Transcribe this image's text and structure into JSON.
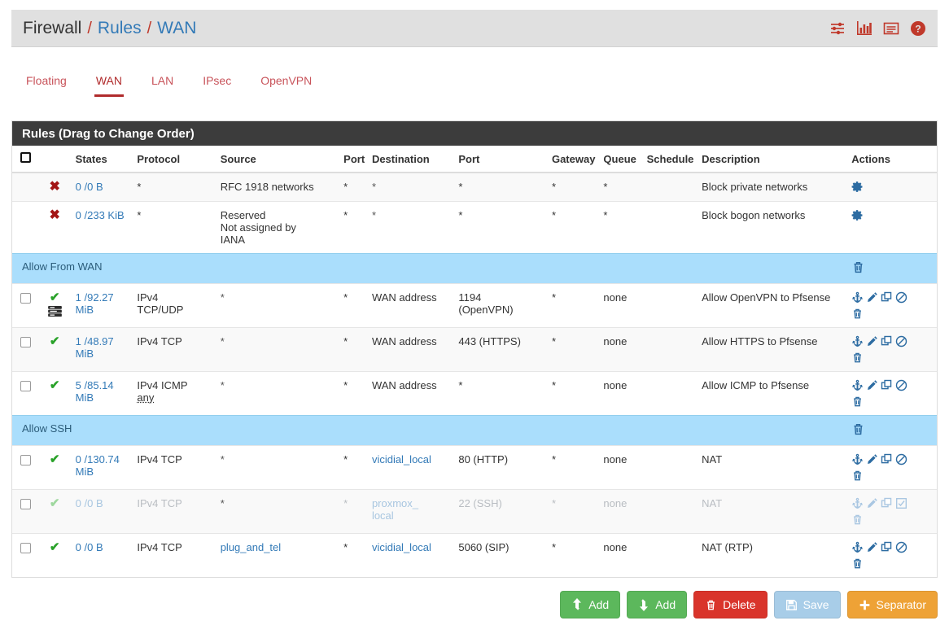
{
  "header": {
    "breadcrumb": [
      {
        "text": "Firewall",
        "type": "static"
      },
      {
        "text": "Rules",
        "type": "link"
      },
      {
        "text": "WAN",
        "type": "link"
      }
    ],
    "separator": "/",
    "icons": [
      {
        "name": "sliders-icon",
        "title": "Advanced"
      },
      {
        "name": "bar-chart-icon",
        "title": "Status"
      },
      {
        "name": "log-list-icon",
        "title": "Logs"
      },
      {
        "name": "help-icon",
        "title": "Help"
      }
    ],
    "accent_color": "#c0392b",
    "link_color": "#337ab7"
  },
  "tabs": [
    {
      "label": "Floating",
      "active": false
    },
    {
      "label": "WAN",
      "active": true
    },
    {
      "label": "LAN",
      "active": false
    },
    {
      "label": "IPsec",
      "active": false
    },
    {
      "label": "OpenVPN",
      "active": false
    }
  ],
  "panel": {
    "title": "Rules (Drag to Change Order)",
    "columns": [
      "",
      "",
      "States",
      "Protocol",
      "Source",
      "Port",
      "Destination",
      "Port",
      "Gateway",
      "Queue",
      "Schedule",
      "Description",
      "Actions"
    ],
    "col_labels": {
      "states": "States",
      "protocol": "Protocol",
      "source": "Source",
      "source_port": "Port",
      "destination": "Destination",
      "dest_port": "Port",
      "gateway": "Gateway",
      "queue": "Queue",
      "schedule": "Schedule",
      "description": "Description",
      "actions": "Actions"
    }
  },
  "rows": [
    {
      "kind": "rule",
      "checkbox": false,
      "status": "block",
      "logged": false,
      "disabled": false,
      "alt": true,
      "states": "0 /0 B",
      "protocol": "*",
      "protocol2": "",
      "source": "RFC 1918 networks",
      "source_link": false,
      "source_port": "*",
      "destination": "*",
      "destination_link": false,
      "dest_port": "*",
      "gateway": "*",
      "queue": "*",
      "schedule": "",
      "description": "Block private networks",
      "actions": [
        "gear-icon"
      ]
    },
    {
      "kind": "rule",
      "checkbox": false,
      "status": "block",
      "logged": false,
      "disabled": false,
      "alt": false,
      "states": "0 /233 KiB",
      "protocol": "*",
      "protocol2": "",
      "source": "Reserved\nNot assigned by\nIANA",
      "source_link": false,
      "source_port": "*",
      "destination": "*",
      "destination_link": false,
      "dest_port": "*",
      "gateway": "*",
      "queue": "*",
      "schedule": "",
      "description": "Block bogon networks",
      "actions": [
        "gear-icon"
      ]
    },
    {
      "kind": "separator",
      "label": "Allow From WAN",
      "actions": [
        "trash-icon"
      ]
    },
    {
      "kind": "rule",
      "checkbox": true,
      "status": "pass",
      "logged": true,
      "disabled": false,
      "alt": false,
      "states": "1 /92.27 MiB",
      "protocol": "IPv4",
      "protocol2": "TCP/UDP",
      "source": "*",
      "source_link": false,
      "source_port": "*",
      "destination": "WAN address",
      "destination_link": false,
      "dest_port": "1194\n(OpenVPN)",
      "gateway": "*",
      "queue": "none",
      "schedule": "",
      "description": "Allow OpenVPN to Pfsense",
      "actions": [
        "anchor-icon",
        "pencil-icon",
        "copy-icon",
        "ban-icon",
        "trash-icon"
      ]
    },
    {
      "kind": "rule",
      "checkbox": true,
      "status": "pass",
      "logged": false,
      "disabled": false,
      "alt": true,
      "states": "1 /48.97 MiB",
      "protocol": "IPv4 TCP",
      "protocol2": "",
      "source": "*",
      "source_link": false,
      "source_port": "*",
      "destination": "WAN address",
      "destination_link": false,
      "dest_port": "443 (HTTPS)",
      "gateway": "*",
      "queue": "none",
      "schedule": "",
      "description": "Allow HTTPS to Pfsense",
      "actions": [
        "anchor-icon",
        "pencil-icon",
        "copy-icon",
        "ban-icon",
        "trash-icon"
      ]
    },
    {
      "kind": "rule",
      "checkbox": true,
      "status": "pass",
      "logged": false,
      "disabled": false,
      "alt": false,
      "states": "5 /85.14 MiB",
      "protocol": "IPv4 ICMP",
      "protocol2": "any",
      "source": "*",
      "source_link": false,
      "source_port": "*",
      "destination": "WAN address",
      "destination_link": false,
      "dest_port": "*",
      "gateway": "*",
      "queue": "none",
      "schedule": "",
      "description": "Allow ICMP to Pfsense",
      "actions": [
        "anchor-icon",
        "pencil-icon",
        "copy-icon",
        "ban-icon",
        "trash-icon"
      ]
    },
    {
      "kind": "separator",
      "label": "Allow SSH",
      "actions": [
        "trash-icon"
      ]
    },
    {
      "kind": "rule",
      "checkbox": true,
      "status": "pass",
      "logged": false,
      "disabled": false,
      "alt": false,
      "states": "0 /130.74 MiB",
      "protocol": "IPv4 TCP",
      "protocol2": "",
      "source": "*",
      "source_link": false,
      "source_port": "*",
      "destination": "vicidial_local",
      "destination_link": true,
      "dest_port": "80 (HTTP)",
      "gateway": "*",
      "queue": "none",
      "schedule": "",
      "description": "NAT",
      "actions": [
        "anchor-icon",
        "pencil-icon",
        "copy-icon",
        "ban-icon",
        "trash-icon"
      ]
    },
    {
      "kind": "rule",
      "checkbox": true,
      "status": "pass",
      "logged": false,
      "disabled": true,
      "alt": true,
      "states": "0 /0 B",
      "protocol": "IPv4 TCP",
      "protocol2": "",
      "source": "*",
      "source_link": false,
      "source_port": "*",
      "destination": "proxmox_\nlocal",
      "destination_link": true,
      "dest_port": "22 (SSH)",
      "gateway": "*",
      "queue": "none",
      "schedule": "",
      "description": "NAT",
      "actions": [
        "anchor-icon",
        "pencil-icon",
        "copy-icon",
        "enable-check-icon",
        "trash-icon"
      ]
    },
    {
      "kind": "rule",
      "checkbox": true,
      "status": "pass",
      "logged": false,
      "disabled": false,
      "alt": false,
      "states": "0 /0 B",
      "protocol": "IPv4 TCP",
      "protocol2": "",
      "source": "plug_and_tel",
      "source_link": true,
      "source_port": "*",
      "destination": "vicidial_local",
      "destination_link": true,
      "dest_port": "5060 (SIP)",
      "gateway": "*",
      "queue": "none",
      "schedule": "",
      "description": "NAT (RTP)",
      "actions": [
        "anchor-icon",
        "pencil-icon",
        "copy-icon",
        "ban-icon",
        "trash-icon"
      ]
    }
  ],
  "footer_buttons": [
    {
      "label": "Add",
      "icon": "arrow-up-icon",
      "style": "green",
      "name": "add-up-button"
    },
    {
      "label": "Add",
      "icon": "arrow-down-icon",
      "style": "green",
      "name": "add-down-button"
    },
    {
      "label": "Delete",
      "icon": "trash-icon",
      "style": "red",
      "name": "delete-button"
    },
    {
      "label": "Save",
      "icon": "floppy-icon",
      "style": "blue",
      "name": "save-button"
    },
    {
      "label": "Separator",
      "icon": "plus-icon",
      "style": "orange",
      "name": "separator-button"
    }
  ],
  "colors": {
    "brand_red": "#c0392b",
    "link_blue": "#337ab7",
    "separator_blue": "#aadefc",
    "panel_dark": "#3c3c3c",
    "pass_green": "#2aa22a",
    "block_red": "#a31515"
  }
}
